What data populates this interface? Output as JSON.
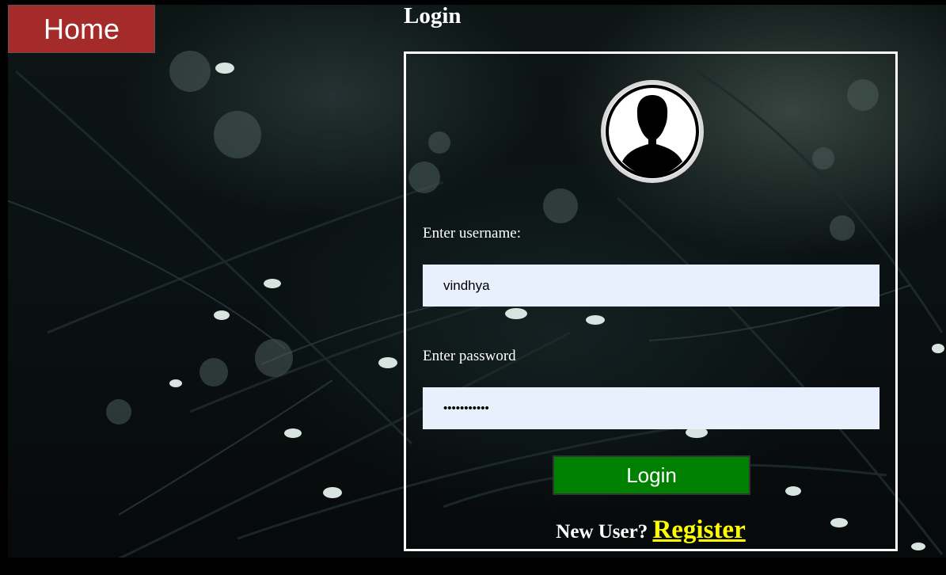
{
  "nav": {
    "home_label": "Home"
  },
  "page": {
    "title": "Login"
  },
  "form": {
    "username_label": "Enter username:",
    "username_value": "vindhya",
    "password_label": "Enter password",
    "password_value": "•••••••••••",
    "submit_label": "Login",
    "new_user_text": "New User?",
    "register_label": "Register"
  },
  "colors": {
    "home_button": "#a52a2a",
    "login_button": "#008000",
    "register_link": "#ffff00",
    "input_background": "#e8f0fe"
  },
  "icons": {
    "avatar": "user-silhouette-icon"
  }
}
